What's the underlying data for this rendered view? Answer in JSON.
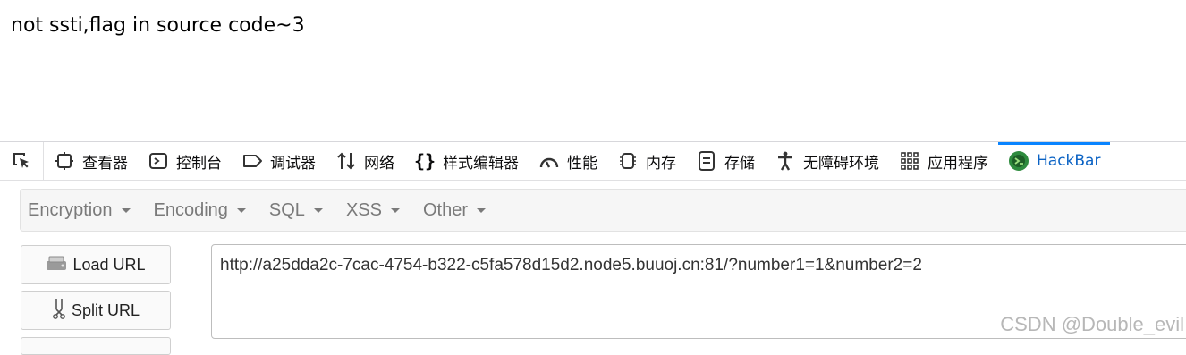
{
  "page": {
    "text": "not ssti,flag in source code~3"
  },
  "devtools": {
    "tabs": [
      {
        "label": "查看器",
        "icon": "inspector-icon"
      },
      {
        "label": "控制台",
        "icon": "console-icon"
      },
      {
        "label": "调试器",
        "icon": "debugger-icon"
      },
      {
        "label": "网络",
        "icon": "network-icon"
      },
      {
        "label": "样式编辑器",
        "icon": "style-editor-icon"
      },
      {
        "label": "性能",
        "icon": "performance-icon"
      },
      {
        "label": "内存",
        "icon": "memory-icon"
      },
      {
        "label": "存储",
        "icon": "storage-icon"
      },
      {
        "label": "无障碍环境",
        "icon": "accessibility-icon"
      },
      {
        "label": "应用程序",
        "icon": "application-icon"
      },
      {
        "label": "HackBar",
        "icon": "hackbar-icon",
        "active": true
      }
    ],
    "accent": "#0a84ff"
  },
  "hackbar": {
    "menu": [
      "Encryption",
      "Encoding",
      "SQL",
      "XSS",
      "Other"
    ],
    "load_url": "Load URL",
    "split_url": "Split URL",
    "url": "http://a25dda2c-7cac-4754-b322-c5fa578d15d2.node5.buuoj.cn:81/?number1=1&number2=2"
  },
  "watermark": "CSDN @Double_evil"
}
